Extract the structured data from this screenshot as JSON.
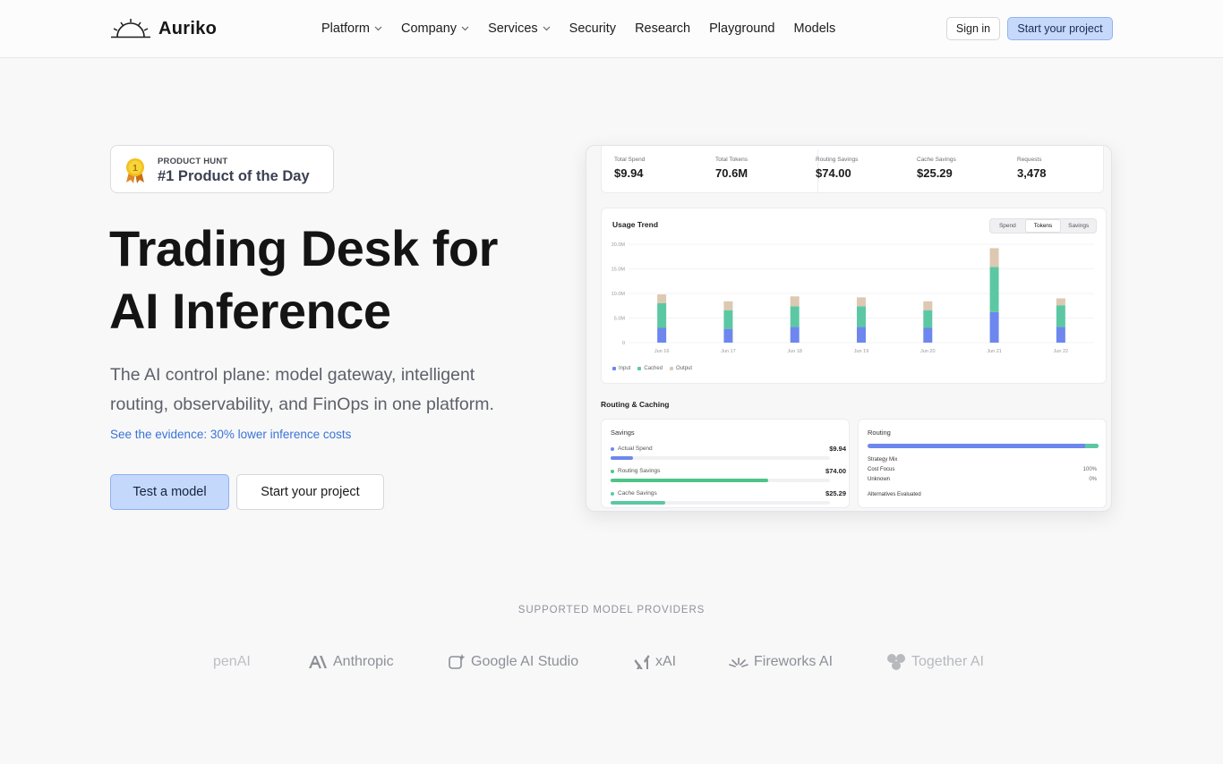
{
  "nav": {
    "brand": "Auriko",
    "items": [
      {
        "label": "Platform",
        "dropdown": true
      },
      {
        "label": "Company",
        "dropdown": true
      },
      {
        "label": "Services",
        "dropdown": true
      },
      {
        "label": "Security",
        "dropdown": false
      },
      {
        "label": "Research",
        "dropdown": false
      },
      {
        "label": "Playground",
        "dropdown": false
      },
      {
        "label": "Models",
        "dropdown": false
      }
    ],
    "sign_in": "Sign in",
    "start_project": "Start your project"
  },
  "hero": {
    "badge_small": "PRODUCT HUNT",
    "badge_big": "#1 Product of the Day",
    "badge_medal_number": "1",
    "title_line1": "Trading Desk for",
    "title_line2": "AI Inference",
    "subtitle": "The AI control plane: model gateway, intelligent routing, observability, and FinOps in one platform.",
    "evidence_link": "See the evidence: 30% lower inference costs",
    "cta_primary": "Test a model",
    "cta_secondary": "Start your project"
  },
  "dashboard": {
    "stats": [
      {
        "label": "Total Spend",
        "value": "$9.94"
      },
      {
        "label": "Total Tokens",
        "value": "70.6M"
      },
      {
        "label": "Routing Savings",
        "value": "$74.00"
      },
      {
        "label": "Cache Savings",
        "value": "$25.29"
      },
      {
        "label": "Requests",
        "value": "3,478"
      }
    ],
    "trend_title": "Usage Trend",
    "trend_tabs": [
      {
        "label": "Spend",
        "active": false
      },
      {
        "label": "Tokens",
        "active": true
      },
      {
        "label": "Savings",
        "active": false
      }
    ],
    "routing_caching_title": "Routing & Caching",
    "savings": {
      "title": "Savings",
      "rows": [
        {
          "label": "Actual Spend",
          "amount": "$9.94",
          "fraction": 0.1,
          "color": "#6d87ee"
        },
        {
          "label": "Routing Savings",
          "amount": "$74.00",
          "fraction": 0.72,
          "color": "#4fc487"
        },
        {
          "label": "Cache Savings",
          "amount": "$25.29",
          "fraction": 0.25,
          "color": "#5cc8a3"
        }
      ]
    },
    "routing": {
      "title": "Routing",
      "bar_fraction_primary": 0.94,
      "strategy_mix_label": "Strategy Mix",
      "strategies": [
        {
          "name": "Cost Focus",
          "pct": "100%"
        },
        {
          "name": "Unknown",
          "pct": "0%"
        }
      ],
      "alternatives_label": "Alternatives Evaluated"
    }
  },
  "chart_data": {
    "type": "bar",
    "stacked": true,
    "title": "Usage Trend",
    "categories": [
      "Jun 16",
      "Jun 17",
      "Jun 18",
      "Jun 19",
      "Jun 20",
      "Jun 21",
      "Jun 22"
    ],
    "y_ticks": [
      "0",
      "5.0M",
      "10.0M",
      "15.0M",
      "20.0M"
    ],
    "ylim": [
      0,
      20
    ],
    "series": [
      {
        "name": "Input",
        "color": "#6d87ee",
        "values": [
          3.0,
          2.8,
          3.2,
          3.2,
          3.0,
          6.2,
          3.2
        ]
      },
      {
        "name": "Cached",
        "color": "#5cc8a3",
        "values": [
          5.0,
          3.8,
          4.2,
          4.2,
          3.6,
          9.2,
          4.4
        ]
      },
      {
        "name": "Output",
        "color": "#ddc8b2",
        "values": [
          1.8,
          1.8,
          2.0,
          1.8,
          1.8,
          3.8,
          1.4
        ]
      }
    ],
    "grid": true,
    "legend": "bottom-left"
  },
  "providers": {
    "title": "SUPPORTED MODEL PROVIDERS",
    "items": [
      {
        "name": "OpenAI",
        "visible_text": "penAI",
        "icon": "openai-icon"
      },
      {
        "name": "Anthropic",
        "visible_text": "Anthropic",
        "icon": "anthropic-icon"
      },
      {
        "name": "Google AI Studio",
        "visible_text": "Google AI Studio",
        "icon": "google-ai-studio-icon"
      },
      {
        "name": "xAI",
        "visible_text": "xAI",
        "icon": "xai-icon"
      },
      {
        "name": "Fireworks AI",
        "visible_text": "Fireworks AI",
        "icon": "fireworks-icon"
      },
      {
        "name": "Together AI",
        "visible_text": "Together AI",
        "icon": "together-icon"
      }
    ]
  }
}
